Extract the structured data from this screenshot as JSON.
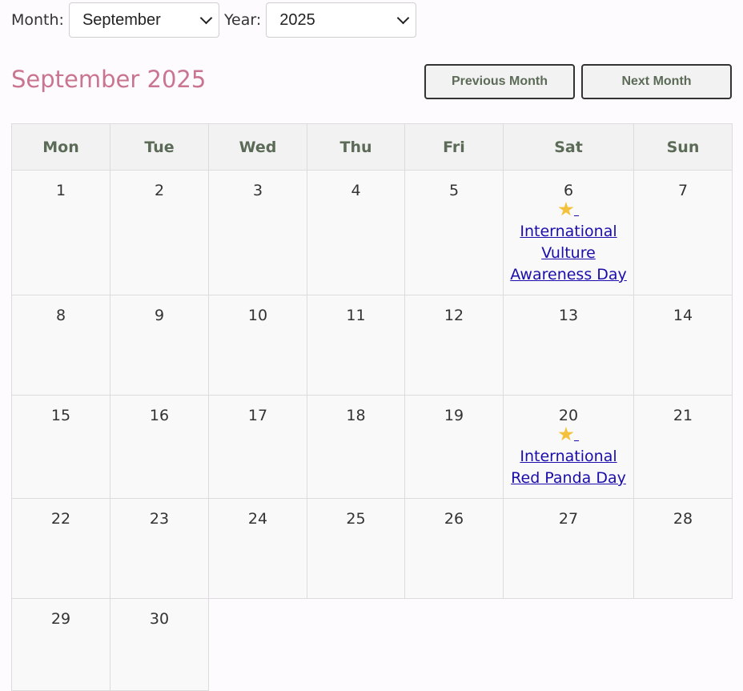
{
  "controls": {
    "month_label": "Month:",
    "month_value": "September",
    "year_label": "Year:",
    "year_value": "2025"
  },
  "title": "September 2025",
  "buttons": {
    "prev": "Previous Month",
    "next": "Next Month"
  },
  "weekdays": [
    "Mon",
    "Tue",
    "Wed",
    "Thu",
    "Fri",
    "Sat",
    "Sun"
  ],
  "weeks": [
    [
      {
        "day": "1"
      },
      {
        "day": "2"
      },
      {
        "day": "3"
      },
      {
        "day": "4"
      },
      {
        "day": "5"
      },
      {
        "day": "6",
        "event": "International Vulture Awareness Day",
        "event_icon": "star-icon"
      },
      {
        "day": "7"
      }
    ],
    [
      {
        "day": "8"
      },
      {
        "day": "9"
      },
      {
        "day": "10"
      },
      {
        "day": "11"
      },
      {
        "day": "12"
      },
      {
        "day": "13"
      },
      {
        "day": "14"
      }
    ],
    [
      {
        "day": "15"
      },
      {
        "day": "16"
      },
      {
        "day": "17"
      },
      {
        "day": "18"
      },
      {
        "day": "19"
      },
      {
        "day": "20",
        "event": "International Red Panda Day",
        "event_icon": "star-icon"
      },
      {
        "day": "21"
      }
    ],
    [
      {
        "day": "22"
      },
      {
        "day": "23"
      },
      {
        "day": "24"
      },
      {
        "day": "25"
      },
      {
        "day": "26"
      },
      {
        "day": "27"
      },
      {
        "day": "28"
      }
    ],
    [
      {
        "day": "29"
      },
      {
        "day": "30"
      },
      null,
      null,
      null,
      null,
      null
    ]
  ],
  "colors": {
    "title": "#c9758f",
    "header_text": "#5c6b57",
    "event_link": "#1a0dab",
    "star": "#f3c13a"
  }
}
